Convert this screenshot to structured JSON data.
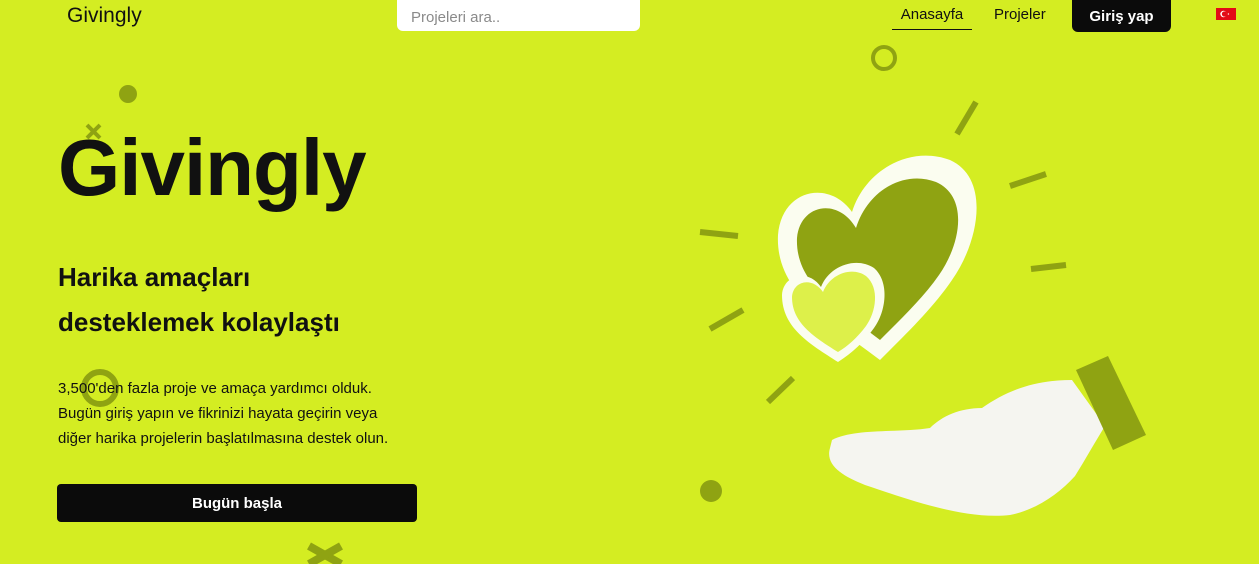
{
  "header": {
    "brand": "Givingly",
    "search_placeholder": "Projeleri ara..",
    "nav": {
      "home": "Anasayfa",
      "projects": "Projeler"
    },
    "login": "Giriş yap",
    "language_icon": "turkey-flag-icon"
  },
  "hero": {
    "title": "Givingly",
    "subtitle_line1": "Harika amaçları",
    "subtitle_line2": "desteklemek kolaylaştı",
    "desc_line1": "3,500'den fazla proje ve amaça yardımcı olduk.",
    "desc_line2": "Bugün giriş yapın ve fikrinizi hayata geçirin veya",
    "desc_line3": "diğer harika projelerin başlatılmasına destek olun.",
    "cta": "Bugün başla"
  },
  "illustration": {
    "icon": "hand-holding-hearts-icon"
  },
  "colors": {
    "background": "#d4ed22",
    "accent_dark": "#0b0b0b",
    "shape_olive": "#8fa312"
  }
}
